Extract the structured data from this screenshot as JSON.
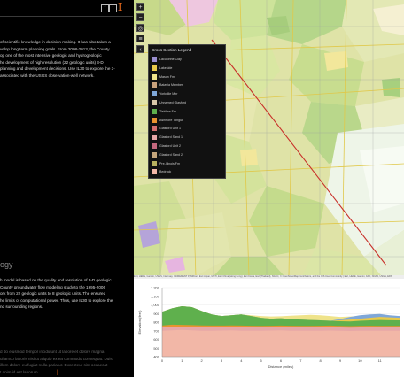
{
  "sidebar": {
    "social": {
      "facebook": "f",
      "twitter": "t"
    },
    "logo": "I",
    "paragraph_1": [
      "of scientific knowledge in decision making. It has also taken a",
      "velop long term planning goals. From 2008-2013, the County",
      "op one of the most intensive geologic and hydrogeologic",
      "he development of high-resolution (22 geologic units) 3-D",
      "planning and development decisions. Use IL30 to explore the 3-",
      "associated with the USGS observation-well network."
    ],
    "section_title": "ogy",
    "paragraph_2": [
      "h model is based on the quality and resolution of 3-D geologic",
      "County groundwater flow modeling study to the 1995-2006",
      "ork from 22 geologic units to 8 geologic units. The ensured",
      "he limits of computational power. Thus, use IL30 to explore the",
      "nd surrounding regions."
    ],
    "paragraph_3": [
      "d do eiusmod tempor incididunt ut labore et dolore magna",
      "ullamco laboris nisi ut aliquip ex ea commodo consequat. Duis",
      "illum dolore eu fugiat nulla pariatur. Excepteur sint occaecat",
      "t anim id est laborum."
    ]
  },
  "map": {
    "zoom_in": "+",
    "zoom_out": "−",
    "tool_1": "◎",
    "tool_2": "≡",
    "tool_3": "‹",
    "attribution": "Esri, HERE, Garmin, USGS, Intermap, INCREMENT P, NRCan, Esri Japan, METI, Esri China (Hong Kong), Esri Korea, Esri (Thailand), NGCC, © OpenStreetMap contributors, and the GIS User Community | Esri, HERE, Garmin, FAO, NOAA, USGS, EPA"
  },
  "legend": {
    "title": "Cross Section Legend",
    "items": [
      {
        "label": "Lacustrine Clay",
        "color": "#9b8fd0"
      },
      {
        "label": "Lakeside",
        "color": "#e9c94a"
      },
      {
        "label": "Mason Fm",
        "color": "#efe38a"
      },
      {
        "label": "Batavia Member",
        "color": "#c9a27c"
      },
      {
        "label": "Yorkville Mbr",
        "color": "#7fa7d8"
      },
      {
        "label": "Unnamed Glasford",
        "color": "#d8c7a8"
      },
      {
        "label": "Tiskilwa Fm",
        "color": "#5fb04d"
      },
      {
        "label": "Ashmore Tongue",
        "color": "#e8932f"
      },
      {
        "label": "Glasford Unit 1",
        "color": "#d36e6e"
      },
      {
        "label": "Glasford Sand 1",
        "color": "#e7a7a7"
      },
      {
        "label": "Glasford Unit 2",
        "color": "#c4687d"
      },
      {
        "label": "Glasford Sand 2",
        "color": "#c4a57b"
      },
      {
        "label": "Pre-Illinois Fm",
        "color": "#b8b15f"
      },
      {
        "label": "Bedrock",
        "color": "#f2b7a7"
      }
    ]
  },
  "chart_data": {
    "type": "area",
    "ylabel": "Elevation (feet)",
    "xlabel": "Distance (miles)",
    "ylim": [
      400,
      1200
    ],
    "yticks": [
      "1,200",
      "1,100",
      "1,000",
      "900",
      "800",
      "700",
      "600",
      "500",
      "400"
    ],
    "xlim": [
      0,
      12
    ],
    "xticks": [
      "0",
      "1",
      "2",
      "3",
      "4",
      "5",
      "6",
      "7",
      "8",
      "9",
      "10",
      "11"
    ],
    "x": [
      0,
      0.5,
      1,
      1.5,
      2,
      2.5,
      3,
      3.5,
      4,
      4.5,
      5,
      5.5,
      6,
      6.5,
      7,
      7.5,
      8,
      8.5,
      9,
      9.5,
      10,
      10.5,
      11,
      11.5,
      12
    ],
    "layers": [
      {
        "name": "Bedrock",
        "color": "#f2b7a7",
        "top": [
          700,
          705,
          710,
          705,
          700,
          700,
          702,
          705,
          700,
          700,
          700,
          702,
          705,
          700,
          700,
          700,
          700,
          702,
          700,
          698,
          700,
          700,
          700,
          700,
          700
        ]
      },
      {
        "name": "Glasford Sand 1",
        "color": "#e7a7a7",
        "top": [
          740,
          745,
          748,
          745,
          742,
          740,
          742,
          745,
          742,
          740,
          738,
          740,
          742,
          740,
          738,
          738,
          740,
          742,
          738,
          736,
          738,
          740,
          738,
          738,
          738
        ]
      },
      {
        "name": "Ashmore Tongue",
        "color": "#e8932f",
        "top": [
          760,
          770,
          768,
          765,
          762,
          760,
          760,
          762,
          760,
          758,
          756,
          758,
          760,
          758,
          756,
          756,
          758,
          760,
          756,
          754,
          756,
          758,
          756,
          756,
          756
        ]
      },
      {
        "name": "Tiskilwa Fm",
        "color": "#5fb04d",
        "top": [
          920,
          960,
          985,
          975,
          930,
          890,
          870,
          880,
          890,
          870,
          850,
          840,
          845,
          835,
          830,
          825,
          820,
          815,
          810,
          808,
          815,
          820,
          825,
          822,
          820
        ]
      },
      {
        "name": "Lakeside",
        "color": "#e9c94a",
        "top": [
          920,
          960,
          985,
          975,
          930,
          890,
          870,
          880,
          890,
          870,
          850,
          840,
          845,
          835,
          830,
          825,
          820,
          815,
          822,
          830,
          840,
          850,
          860,
          855,
          850
        ]
      },
      {
        "name": "Yorkville Mbr",
        "color": "#7fa7d8",
        "top": [
          920,
          960,
          985,
          975,
          930,
          890,
          870,
          880,
          890,
          870,
          850,
          840,
          845,
          835,
          830,
          825,
          820,
          815,
          835,
          860,
          880,
          890,
          895,
          880,
          870
        ]
      },
      {
        "name": "Mason Fm",
        "color": "#efe38a",
        "top": [
          920,
          960,
          985,
          975,
          930,
          890,
          870,
          880,
          890,
          880,
          870,
          865,
          868,
          875,
          880,
          885,
          880,
          870,
          860,
          865,
          870,
          875,
          880,
          875,
          870
        ]
      }
    ]
  }
}
